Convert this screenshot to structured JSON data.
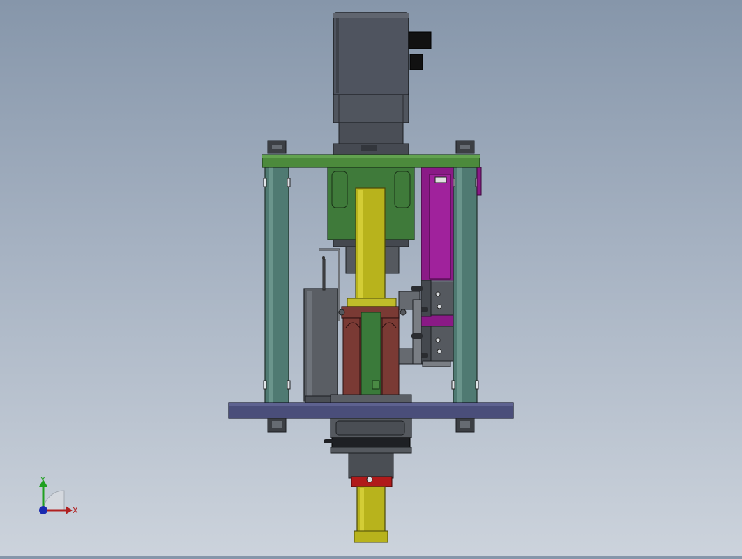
{
  "viewport": {
    "background_top": "#8696aa",
    "background_bottom": "#ccd3dc"
  },
  "colors": {
    "motor": "#4f545f",
    "top_plate": "#4c8a3c",
    "gearbox": "#3f7a3a",
    "yellow_shaft": "#b8b31c",
    "pillar": "#4f7a72",
    "base_plate": "#4a4e7a",
    "magenta_bracket": "#8a1a86",
    "red_block": "#7a3a34",
    "cylinder_block": "#5a5e64",
    "red_collar": "#b01a1a",
    "green_rod": "#3a7a3a"
  },
  "triad": {
    "x_label": "X",
    "y_label": "Y",
    "x_color": "#b02020",
    "y_color": "#20a020",
    "z_color": "#1a2ab0"
  }
}
